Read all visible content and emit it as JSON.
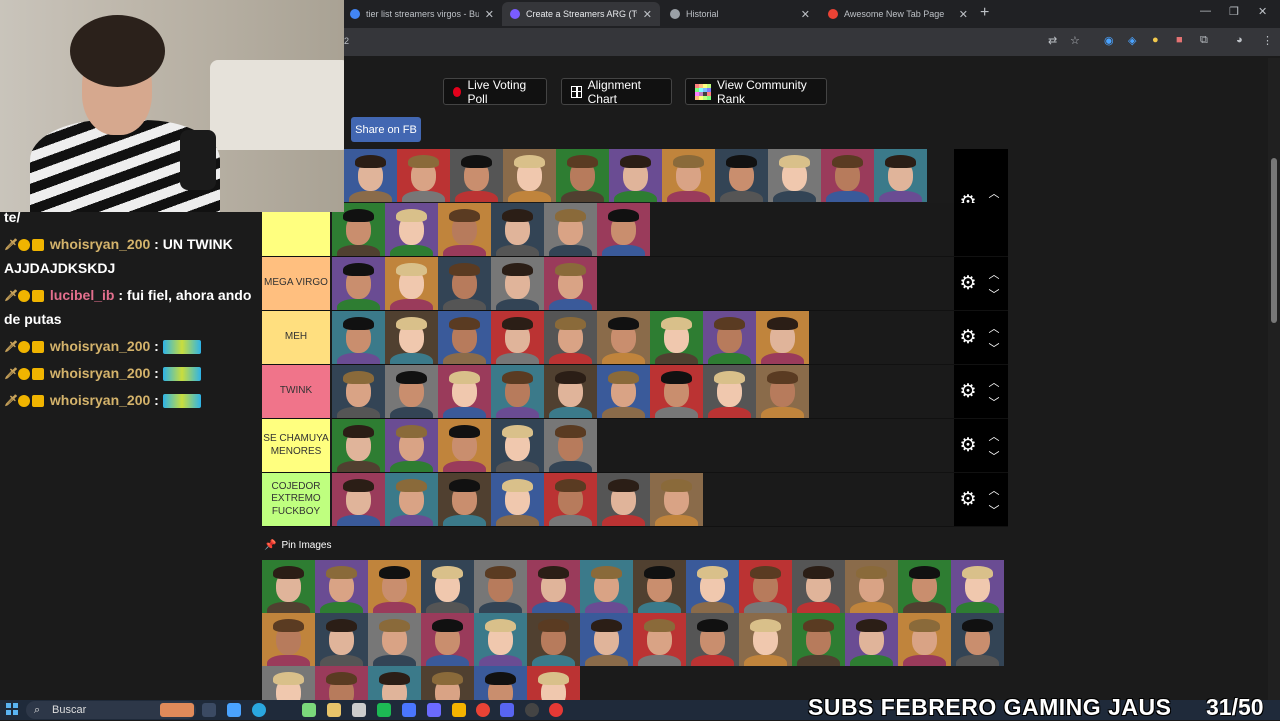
{
  "browser": {
    "tabs": [
      {
        "title": "tier list streamers virgos - Busc",
        "active": false,
        "favicon": "#4285f4"
      },
      {
        "title": "Create a Streamers ARG (Twich",
        "active": true,
        "favicon": "#7a5cff"
      },
      {
        "title": "Historial",
        "active": false,
        "favicon": "#9aa0a6"
      },
      {
        "title": "Awesome New Tab Page",
        "active": false,
        "favicon": "#ea4335"
      }
    ],
    "url_fragment": "2",
    "new_tab": "+",
    "window_controls": {
      "minimize": "—",
      "restore": "❐",
      "close": "✕"
    }
  },
  "toolbar_buttons": {
    "live_voting": "Live Voting Poll",
    "alignment_chart": "Alignment Chart",
    "community_rank": "View Community Rank",
    "share_fb": "Share on FB"
  },
  "tiers": [
    {
      "label": "",
      "color": "#ff7f7f",
      "count": 18
    },
    {
      "label": "",
      "color": "#ffff7f",
      "count": 6
    },
    {
      "label": "MEGA VIRGO",
      "color": "#ffbf7f",
      "count": 5
    },
    {
      "label": "MEH",
      "color": "#ffdf7f",
      "count": 9
    },
    {
      "label": "TWINK",
      "color": "#f0748a",
      "count": 9
    },
    {
      "label": "SE CHAMUYA MENORES",
      "color": "#ffff7f",
      "count": 5
    },
    {
      "label": "COJEDOR EXTREMO FUCKBOY",
      "color": "#bfff7f",
      "count": 7
    }
  ],
  "pin_images": {
    "title": "Pin Images",
    "count": 34
  },
  "chat": {
    "lines": [
      {
        "user": "",
        "text": "te/"
      },
      {
        "user": "whoisryan_200",
        "text": ": UN TWINK AJJDAJDKSKDJ"
      },
      {
        "user": "lucibel_ib",
        "text": ": fui fiel, ahora ando de putas"
      },
      {
        "user": "whoisryan_200",
        "text": ":"
      },
      {
        "user": "whoisryan_200",
        "text": ":"
      },
      {
        "user": "whoisryan_200",
        "text": ":"
      }
    ]
  },
  "taskbar": {
    "search_placeholder": "Buscar",
    "overlay_text": "SUBS FEBRERO GAMING JAUS",
    "overlay_counter": "31/50"
  },
  "colors": {
    "accent_fb": "#4267b2",
    "record_red": "#e3001b",
    "page_bg": "#1b1b1b"
  }
}
